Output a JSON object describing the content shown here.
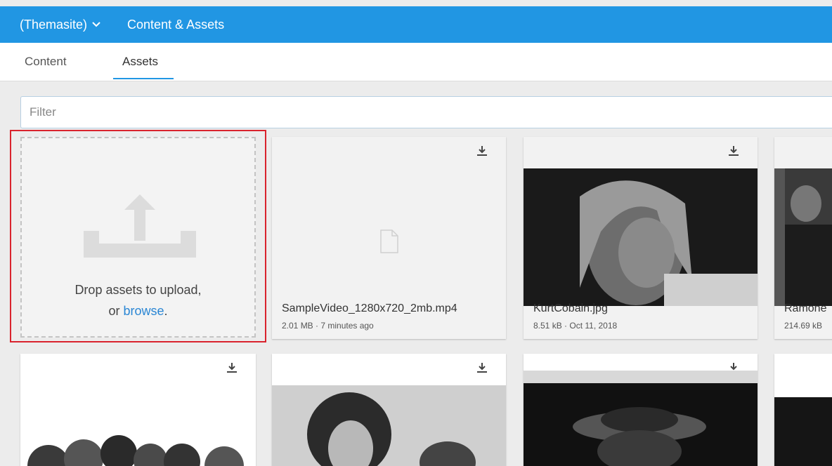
{
  "header": {
    "site_label": "(Themasite)",
    "section_title": "Content & Assets",
    "bg_color": "#2196e3"
  },
  "tabs": [
    {
      "label": "Content"
    },
    {
      "label": "Assets",
      "active": true
    }
  ],
  "filter": {
    "placeholder": "Filter",
    "value": ""
  },
  "dropzone": {
    "line1": "Drop assets to upload,",
    "line2_prefix": "or ",
    "browse_link": "browse",
    "line2_suffix": ".",
    "icon": "upload-icon"
  },
  "assets": [
    {
      "name": "SampleVideo_1280x720_2mb.mp4",
      "meta": "2.01 MB · 7 minutes ago",
      "icon": "file-icon"
    },
    {
      "name": "KurtCobain.jpg",
      "meta": "8.51 kB · Oct 11, 2018"
    },
    {
      "name": "Ramone",
      "meta": "214.69 kB"
    }
  ],
  "icons": {
    "download": "download-icon",
    "dropdown": "chevron-down-icon"
  }
}
